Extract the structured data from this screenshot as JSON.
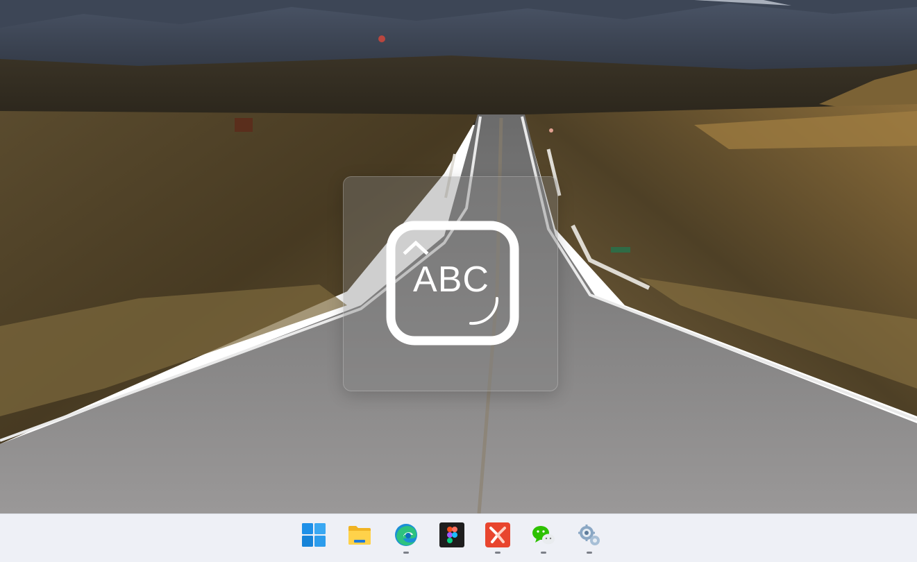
{
  "desktop": {
    "wallpaper": "mountain-road-landscape"
  },
  "osd": {
    "label": "ABC",
    "icon": "caps-lock-icon",
    "background": "#808080"
  },
  "taskbar": {
    "background": "#eef0f6",
    "items": [
      {
        "name": "start",
        "icon": "windows-start-icon",
        "running": false
      },
      {
        "name": "file-explorer",
        "icon": "folder-icon",
        "running": false
      },
      {
        "name": "edge",
        "icon": "edge-browser-icon",
        "running": true
      },
      {
        "name": "figma",
        "icon": "figma-icon",
        "running": false
      },
      {
        "name": "xmind",
        "icon": "xmind-icon",
        "running": true
      },
      {
        "name": "wechat",
        "icon": "wechat-icon",
        "running": true
      },
      {
        "name": "settings",
        "icon": "gears-icon",
        "running": true
      }
    ]
  }
}
